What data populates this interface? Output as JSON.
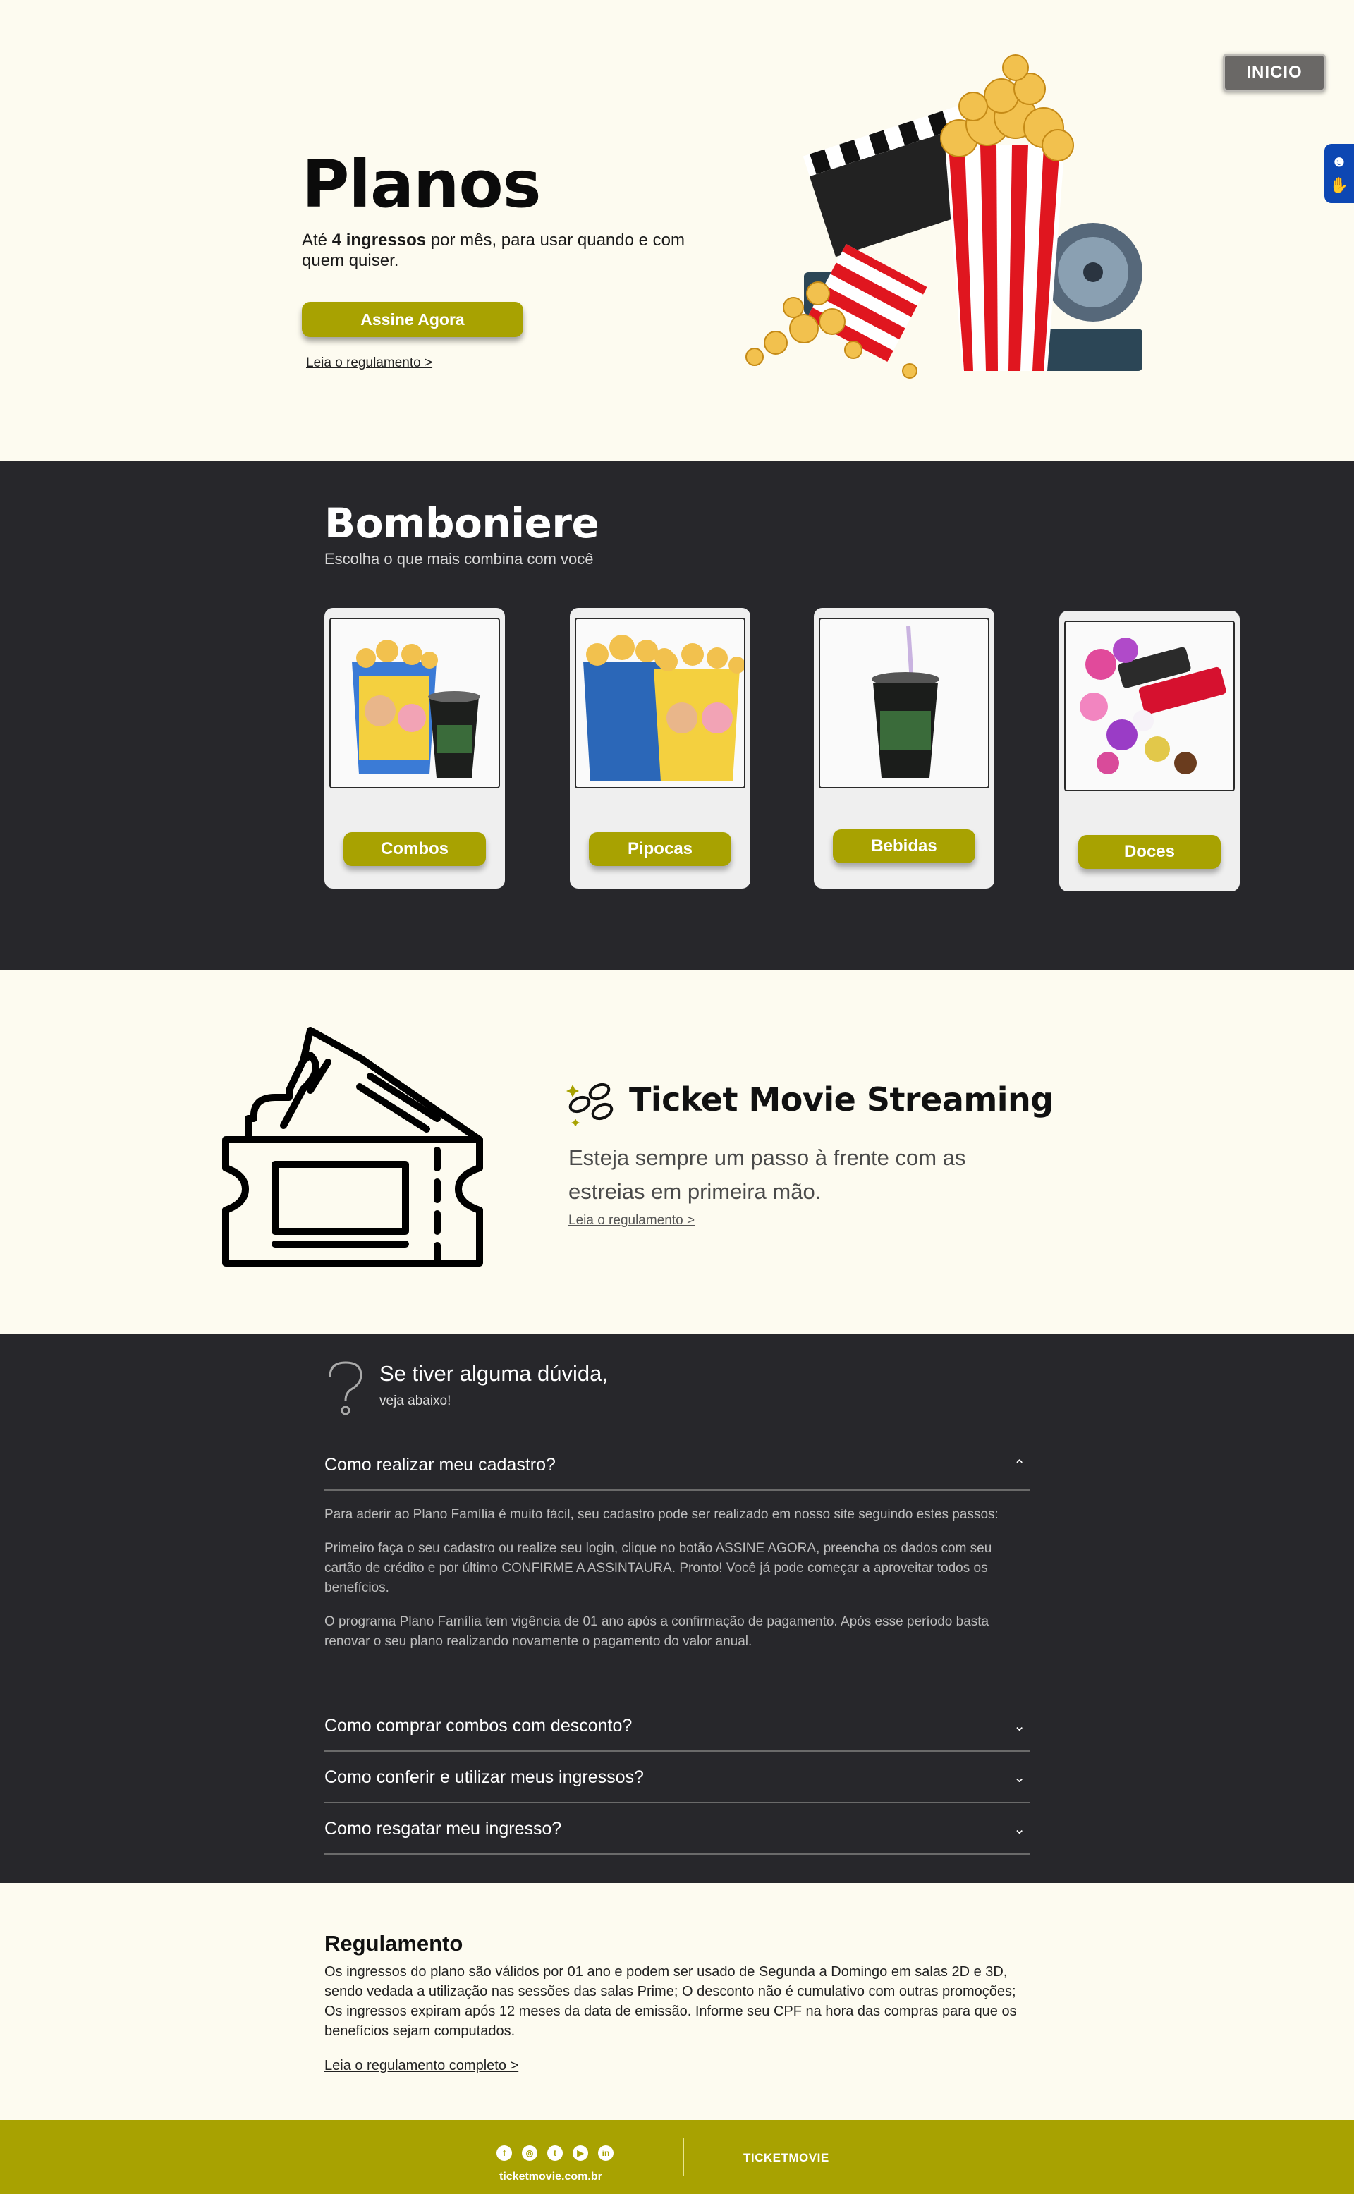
{
  "nav": {
    "inicio_label": "INICIO"
  },
  "accessibility": {
    "icons": [
      "sign-language-icon",
      "hand-icon"
    ]
  },
  "hero": {
    "title": "Planos",
    "subtitle_prefix": "Até ",
    "subtitle_bold": "4 ingressos",
    "subtitle_suffix": " por mês, para usar quando e com quem quiser.",
    "cta_label": "Assine Agora",
    "link_label": "Leia o regulamento >"
  },
  "bomboniere": {
    "title": "Bomboniere",
    "subtitle": "Escolha o que mais combina com você",
    "cards": [
      {
        "label": "Combos"
      },
      {
        "label": "Pipocas"
      },
      {
        "label": "Bebidas"
      },
      {
        "label": "Doces"
      }
    ]
  },
  "streaming": {
    "title": "Ticket Movie Streaming",
    "description": "Esteja sempre um passo à frente com as estreias em primeira mão.",
    "link_label": "Leia o regulamento >"
  },
  "faq": {
    "heading": "Se tiver alguma dúvida,",
    "subheading": "veja abaixo!",
    "items": [
      {
        "question": "Como realizar meu cadastro?",
        "expanded": true
      },
      {
        "question": "Como comprar combos com desconto?",
        "expanded": false
      },
      {
        "question": "Como conferir e utilizar meus ingressos?",
        "expanded": false
      },
      {
        "question": "Como resgatar meu ingresso?",
        "expanded": false
      }
    ],
    "answer": [
      "Para aderir ao Plano Família é muito fácil, seu cadastro pode ser realizado em nosso site seguindo estes passos:",
      "Primeiro faça o seu cadastro ou realize seu login, clique no botão ASSINE AGORA, preencha os dados com seu cartão de crédito e por último CONFIRME A ASSINTAURA. Pronto! Você já pode começar a aproveitar todos os benefícios.",
      "O programa Plano Família tem vigência de 01 ano após a confirmação de pagamento. Após esse período basta renovar o seu plano realizando novamente o pagamento do valor anual."
    ]
  },
  "regulamento": {
    "title": "Regulamento",
    "text": "Os ingressos do plano são válidos por 01 ano e podem ser usado de Segunda a Domingo em salas 2D e 3D, sendo vedada a utilização nas sessões das salas Prime; O desconto não é cumulativo com outras promoções; Os ingressos expiram após 12 meses da data de emissão. Informe seu CPF na hora das compras para que os benefícios sejam computados.",
    "link_label": "Leia o regulamento completo >"
  },
  "footer": {
    "social": [
      "f",
      "◎",
      "t",
      "▶",
      "in"
    ],
    "url": "ticketmovie.com.br",
    "brand": "TICKETMOVIE"
  },
  "colors": {
    "accent": "#a8a201",
    "dark": "#27272b",
    "cream": "#fdfbf0",
    "access_blue": "#0d47b3"
  }
}
